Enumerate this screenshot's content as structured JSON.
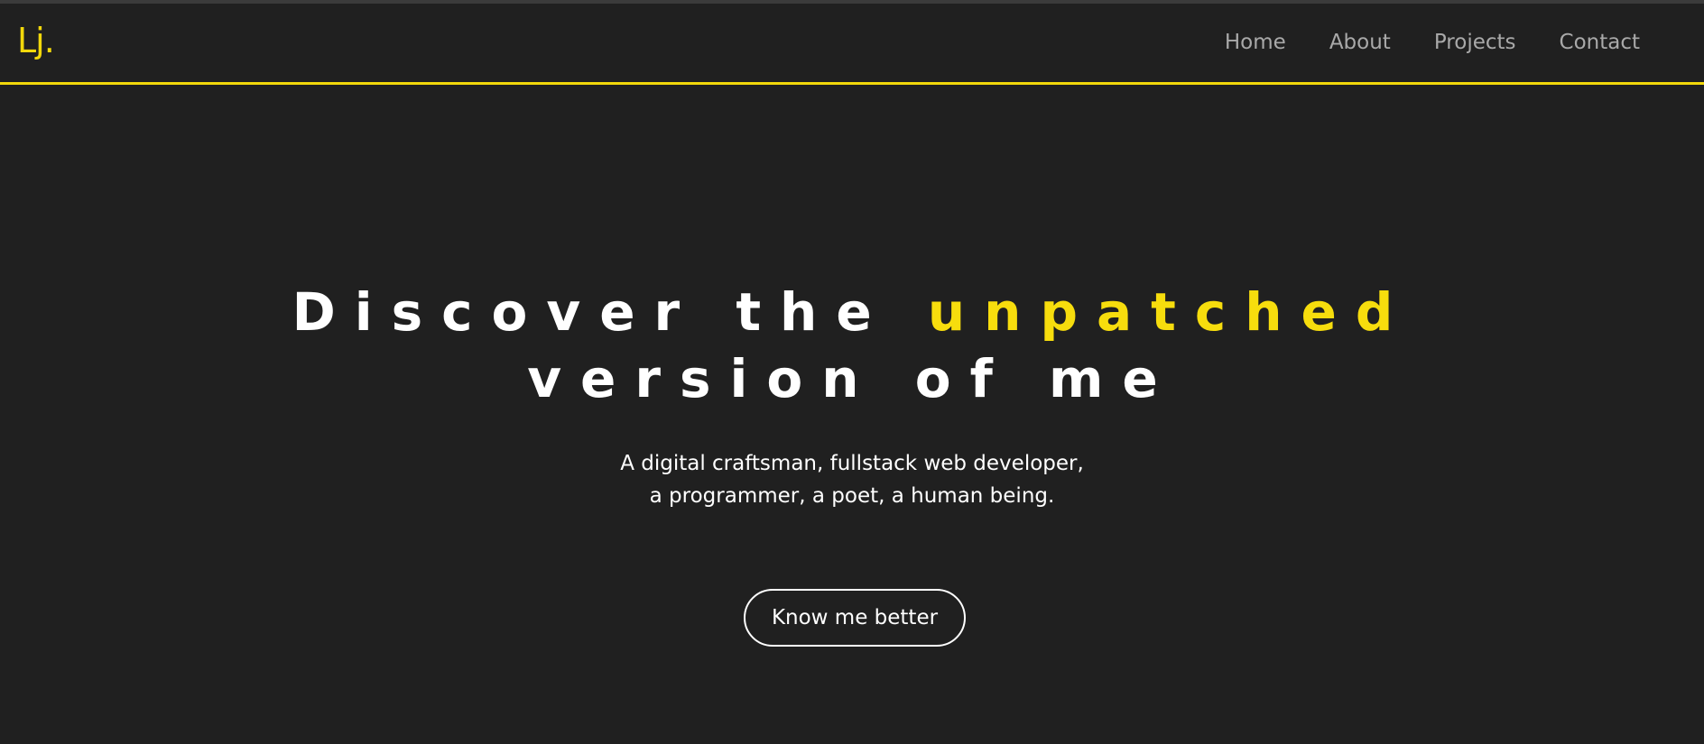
{
  "brand": {
    "logo_text": "Lj.",
    "accent_color": "#f2d80b",
    "background_color": "#202020"
  },
  "nav": {
    "items": [
      {
        "label": "Home"
      },
      {
        "label": "About"
      },
      {
        "label": "Projects"
      },
      {
        "label": "Contact"
      }
    ]
  },
  "hero": {
    "headline_part1": "Discover the ",
    "headline_accent": "unpatched",
    "headline_part2": "version of me",
    "subtitle_line1": "A digital craftsman, fullstack web developer,",
    "subtitle_line2": "a programmer, a poet, a human being.",
    "cta_label": "Know me better"
  }
}
